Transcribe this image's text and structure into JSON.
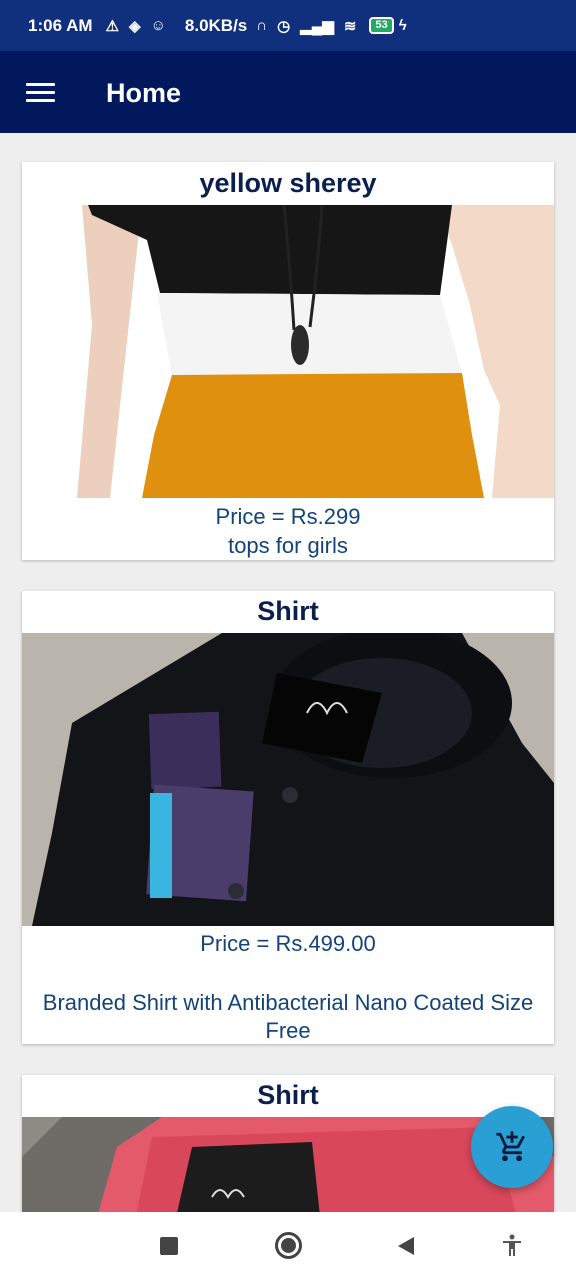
{
  "status": {
    "time": "1:06 AM",
    "speed": "8.0KB/s",
    "battery": "53"
  },
  "appbar": {
    "title": "Home"
  },
  "products": [
    {
      "title": "yellow sherey",
      "price": "Price = Rs.299",
      "description": "tops for girls"
    },
    {
      "title": "Shirt",
      "price": "Price = Rs.499.00",
      "description": "Branded Shirt with Antibacterial Nano Coated Size Free"
    },
    {
      "title": "Shirt"
    }
  ],
  "fab": {
    "icon": "add-shopping-cart-icon"
  },
  "colors": {
    "status_bar": "#10307d",
    "app_bar": "#02185c",
    "text_accent": "#12447a",
    "fab": "#2a9fd4"
  }
}
